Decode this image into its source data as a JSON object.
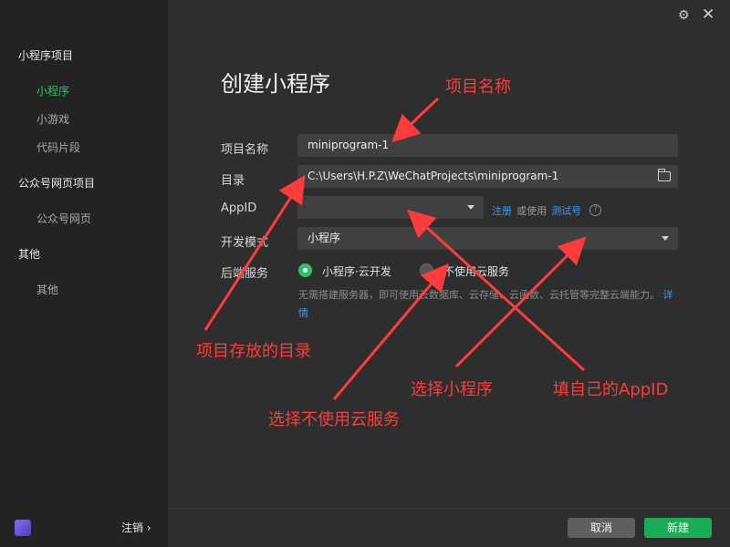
{
  "sidebar": {
    "groups": [
      {
        "label": "小程序项目",
        "items": [
          {
            "label": "小程序",
            "active": true
          },
          {
            "label": "小游戏",
            "active": false
          },
          {
            "label": "代码片段",
            "active": false
          }
        ]
      },
      {
        "label": "公众号网页项目",
        "items": [
          {
            "label": "公众号网页",
            "active": false
          }
        ]
      },
      {
        "label": "其他",
        "items": [
          {
            "label": "其他",
            "active": false
          }
        ]
      }
    ],
    "logout_label": "注销 ›"
  },
  "window": {
    "settings_icon": "gear-icon",
    "close_icon": "close-icon"
  },
  "form": {
    "title": "创建小程序",
    "project_name": {
      "label": "项目名称",
      "value": "miniprogram-1"
    },
    "directory": {
      "label": "目录",
      "value": "C:\\Users\\H.P.Z\\WeChatProjects\\miniprogram-1",
      "icon": "folder-icon"
    },
    "appid": {
      "label": "AppID",
      "value": "",
      "register_link": "注册",
      "or_use": "或使用",
      "test_link": "测试号",
      "help": "?"
    },
    "dev_mode": {
      "label": "开发模式",
      "value": "小程序"
    },
    "backend": {
      "label": "后端服务",
      "options": [
        {
          "label": "小程序·云开发",
          "selected": true
        },
        {
          "label": "不使用云服务",
          "selected": false
        }
      ],
      "description": "无需搭建服务器，即可使用云数据库、云存储、云函数、云托管等完整云端能力。",
      "details_link": "详情"
    }
  },
  "footer": {
    "cancel_label": "取消",
    "create_label": "新建"
  },
  "annotations": {
    "project_name": "项目名称",
    "directory": "项目存放的目录",
    "choose_miniprogram": "选择小程序",
    "fill_appid": "填自己的AppID",
    "no_cloud": "选择不使用云服务"
  },
  "colors": {
    "accent": "#2bc466",
    "link": "#3e9bf0",
    "annotation": "#ff3b3b"
  }
}
